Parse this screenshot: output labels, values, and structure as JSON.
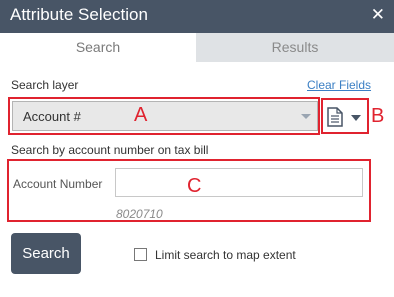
{
  "window": {
    "title": "Attribute Selection",
    "close_glyph": "✕"
  },
  "tabs": [
    {
      "label": "Search",
      "active": true
    },
    {
      "label": "Results",
      "active": false
    }
  ],
  "search_layer": {
    "label": "Search layer",
    "clear_link": "Clear Fields",
    "selected_value": "Account #"
  },
  "description": "Search by account number on tax bill",
  "field": {
    "label": "Account Number",
    "value": "",
    "hint": "8020710"
  },
  "actions": {
    "search_button": "Search",
    "limit_checkbox_label": "Limit search to map extent",
    "limit_checked": false
  },
  "annotations": {
    "a": "A",
    "b": "B",
    "c": "C"
  },
  "colors": {
    "header_bg": "#485566",
    "annotation_red": "#e0232f",
    "link_blue": "#3b7fc4",
    "inactive_tab_bg": "#dfe2e5"
  },
  "icons": {
    "close": "close-icon",
    "dropdown": "chevron-down-icon",
    "file": "document-icon"
  }
}
